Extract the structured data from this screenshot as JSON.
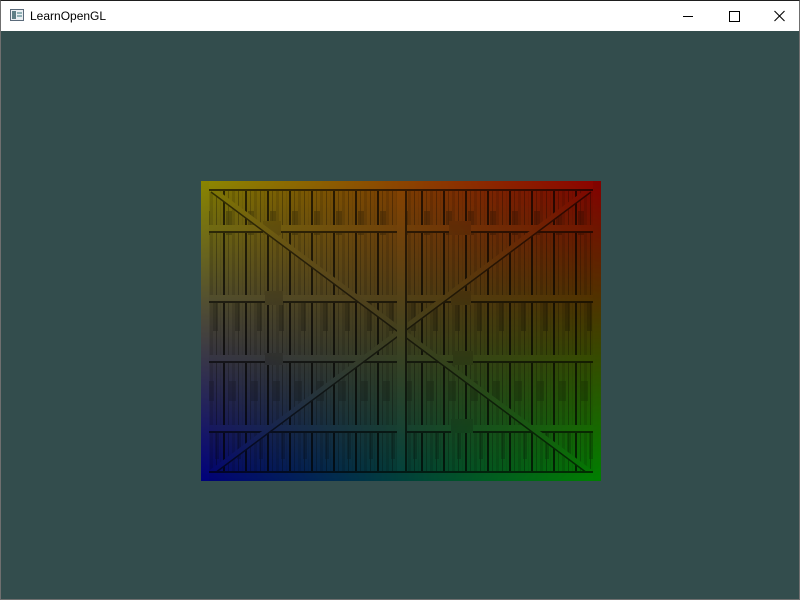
{
  "window": {
    "title": "LearnOpenGL",
    "app_icon": "application-window-icon",
    "controls": [
      {
        "name": "minimize",
        "icon": "minimize-icon"
      },
      {
        "name": "maximize",
        "icon": "maximize-icon"
      },
      {
        "name": "close",
        "icon": "close-icon"
      }
    ]
  },
  "viewport": {
    "clear_color": "#334d4d",
    "quad": {
      "content": "wooden-container-texture",
      "vertex_colors": {
        "top-left": "#ffff00",
        "top-right": "#ff0000",
        "bottom-right": "#00ff00",
        "bottom-left": "#0000ff"
      }
    }
  }
}
